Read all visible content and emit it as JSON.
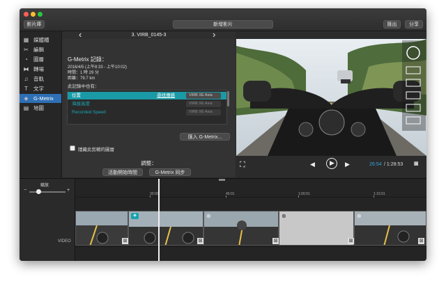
{
  "window": {
    "library_button": "影片庫",
    "title_button": "新增影片",
    "export_button": "匯出",
    "share_button": "分享"
  },
  "sidebar": {
    "items": [
      {
        "label": "媒體櫃",
        "icon": "film-strip-icon",
        "glyph": "▦"
      },
      {
        "label": "編輯",
        "icon": "scissors-icon",
        "glyph": "✂"
      },
      {
        "label": "圖層",
        "icon": "gauge-icon",
        "glyph": "◔"
      },
      {
        "label": "轉場",
        "icon": "transition-icon",
        "glyph": "⧓"
      },
      {
        "label": "音軌",
        "icon": "music-note-icon",
        "glyph": "♫"
      },
      {
        "label": "文字",
        "icon": "text-icon",
        "glyph": "T"
      },
      {
        "label": "G-Metrix",
        "icon": "gmetrix-icon",
        "glyph": "◈"
      },
      {
        "label": "地圖",
        "icon": "map-icon",
        "glyph": "▤"
      }
    ],
    "active_index": 6
  },
  "panel": {
    "clip_title": "3. VIRB_0145-3",
    "prev_glyph": "‹",
    "next_glyph": "›",
    "record_title": "G-Metrix 記錄：",
    "record_date": "2016/4/5 (上午8:33 - 上午10:02)",
    "record_time": "時間：1 時 29 分",
    "record_distance": "距離：79.7 km",
    "contains_label": "此記錄中也有：",
    "table_rows": [
      {
        "name": "位置",
        "link": "尋找傳感",
        "device": "VIRB XE Asia",
        "selected": true
      },
      {
        "name": "海拔高度",
        "link": "",
        "device": "VIRB XE Asia",
        "selected": false
      },
      {
        "name": "Recorded Speed",
        "link": "",
        "device": "VIRB XE Asia",
        "selected": false
      }
    ],
    "import_button": "匯入 G-Metrix...",
    "hide_checkbox_label": "隱藏此剪輯的圖層",
    "hide_checked": false,
    "adjust_label": "調整：",
    "sync_start_button": "活動開始時間",
    "gmetrix_sync_button": "G-Metrix 同步"
  },
  "video": {
    "time_current": "26:54",
    "time_total": "/ 1:28:53"
  },
  "timeline": {
    "zoom_label": "縮放",
    "zoom_minus": "−",
    "zoom_plus": "+",
    "zoom_level": 0.25,
    "ruler": [
      "30:00",
      "45:01",
      "1:00:01",
      "1:15:01"
    ],
    "track_label": "VIDEO"
  }
}
